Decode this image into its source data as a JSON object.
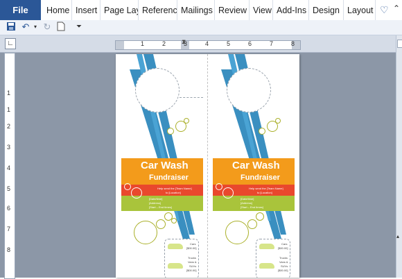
{
  "ribbon": {
    "file_tab": "File",
    "tabs": [
      "Home",
      "Insert",
      "Page Lay",
      "Referenc",
      "Mailings",
      "Review",
      "View",
      "Add-Ins",
      "Design",
      "Layout"
    ]
  },
  "quick_access": {
    "icons": [
      "save-icon",
      "undo-icon",
      "redo-icon",
      "new-document-icon",
      "customize-icon"
    ]
  },
  "ruler": {
    "horizontal_numbers": [
      "1",
      "2",
      "3",
      "4",
      "5",
      "6",
      "7",
      "8"
    ],
    "vertical_numbers": [
      "1",
      "1",
      "2",
      "3",
      "4",
      "5",
      "6",
      "7",
      "8"
    ]
  },
  "hanger": {
    "title_line1": "Car Wash",
    "title_line2": "Fundraiser",
    "info_line1": "Help send the [Team Name]",
    "info_line2": "to [Location]",
    "date_line1": "[Date/time]",
    "date_line2": "[Address]",
    "date_line3": "[Start – End times]",
    "coupon_lines": [
      "Cars",
      "[$00.00]",
      "Trucks",
      "Vans &",
      "SUVs",
      "[$00.00]"
    ]
  },
  "colors": {
    "file_tab": "#2b5797",
    "orange": "#f39b1b",
    "red": "#e9482d",
    "green": "#a9c43b",
    "blue_stripe": "#3a8fc0"
  }
}
